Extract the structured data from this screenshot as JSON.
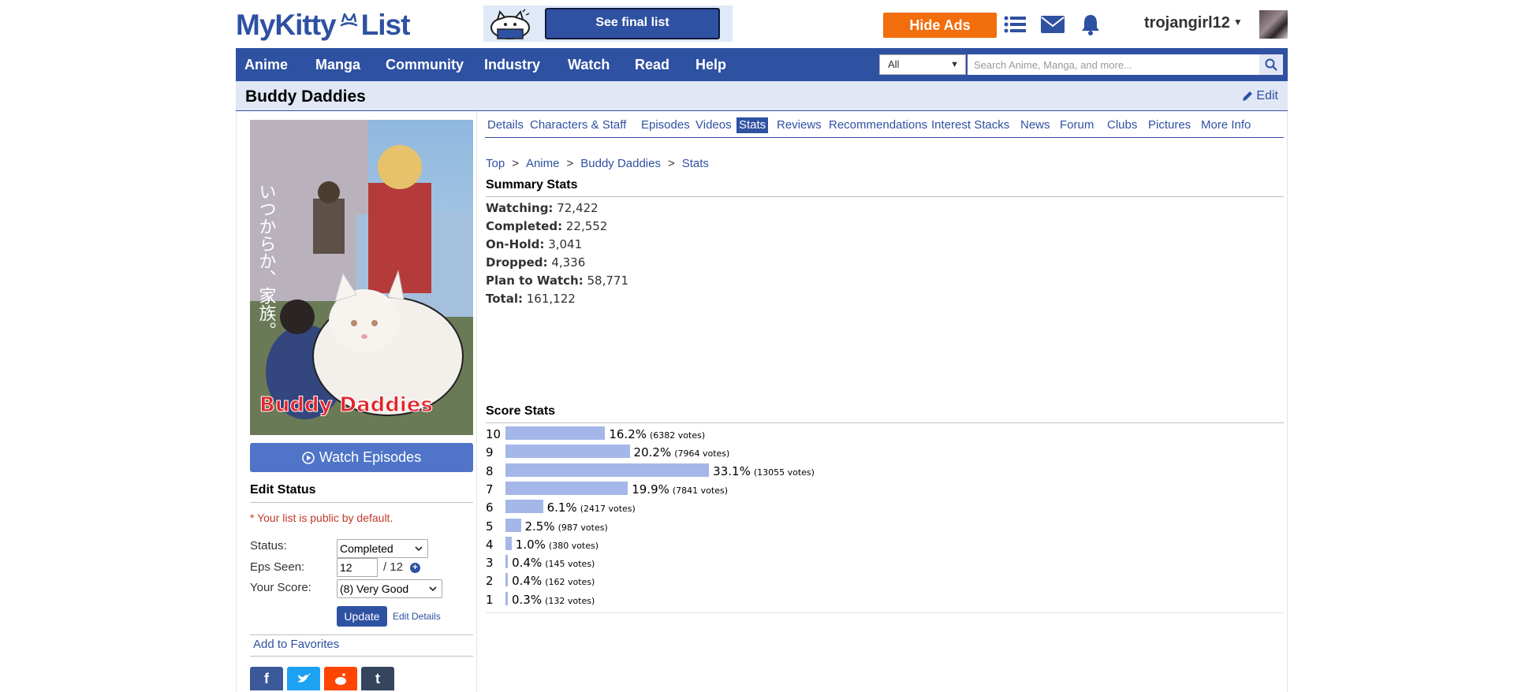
{
  "header": {
    "logo_text_left": "MyKitty",
    "logo_text_right": "List",
    "promo_button": "See final list",
    "hide_ads": "Hide Ads",
    "username": "trojangirl12"
  },
  "nav": {
    "items": [
      "Anime",
      "Manga",
      "Community",
      "Industry",
      "Watch",
      "Read",
      "Help"
    ],
    "search_category": "All",
    "search_placeholder": "Search Anime, Manga, and more..."
  },
  "title": {
    "name": "Buddy Daddies",
    "edit_label": "Edit"
  },
  "sidebar": {
    "poster_text_top": "いつからか、家族。",
    "poster_logo": "Buddy Daddies",
    "watch_episodes": "Watch Episodes",
    "edit_status_heading": "Edit Status",
    "public_note": "* Your list is public by default.",
    "status_label": "Status:",
    "status_value": "Completed",
    "eps_label": "Eps Seen:",
    "eps_value": "12",
    "eps_total": "/ 12",
    "score_label": "Your Score:",
    "score_value": "(8) Very Good",
    "update_button": "Update",
    "edit_details": "Edit Details",
    "add_favorites": "Add to Favorites",
    "share_icons": [
      "facebook-icon",
      "twitter-icon",
      "reddit-icon",
      "tumblr-icon"
    ]
  },
  "tabs": [
    "Details",
    "Characters & Staff",
    "Episodes",
    "Videos",
    "Stats",
    "Reviews",
    "Recommendations",
    "Interest Stacks",
    "News",
    "Forum",
    "Clubs",
    "Pictures",
    "More Info"
  ],
  "active_tab": "Stats",
  "breadcrumb": [
    "Top",
    "Anime",
    "Buddy Daddies",
    "Stats"
  ],
  "summary": {
    "heading": "Summary Stats",
    "rows": [
      {
        "label": "Watching:",
        "value": "72,422"
      },
      {
        "label": "Completed:",
        "value": "22,552"
      },
      {
        "label": "On-Hold:",
        "value": "3,041"
      },
      {
        "label": "Dropped:",
        "value": "4,336"
      },
      {
        "label": "Plan to Watch:",
        "value": "58,771"
      },
      {
        "label": "Total:",
        "value": "161,122"
      }
    ]
  },
  "score_stats": {
    "heading": "Score Stats",
    "rows": [
      {
        "score": "10",
        "pct": 16.2,
        "pct_label": "16.2%",
        "votes": "(6382 votes)"
      },
      {
        "score": "9",
        "pct": 20.2,
        "pct_label": "20.2%",
        "votes": "(7964 votes)"
      },
      {
        "score": "8",
        "pct": 33.1,
        "pct_label": "33.1%",
        "votes": "(13055 votes)"
      },
      {
        "score": "7",
        "pct": 19.9,
        "pct_label": "19.9%",
        "votes": "(7841 votes)"
      },
      {
        "score": "6",
        "pct": 6.1,
        "pct_label": "6.1%",
        "votes": "(2417 votes)"
      },
      {
        "score": "5",
        "pct": 2.5,
        "pct_label": "2.5%",
        "votes": "(987 votes)"
      },
      {
        "score": "4",
        "pct": 1.0,
        "pct_label": "1.0%",
        "votes": "(380 votes)"
      },
      {
        "score": "3",
        "pct": 0.4,
        "pct_label": "0.4%",
        "votes": "(145 votes)"
      },
      {
        "score": "2",
        "pct": 0.4,
        "pct_label": "0.4%",
        "votes": "(162 votes)"
      },
      {
        "score": "1",
        "pct": 0.3,
        "pct_label": "0.3%",
        "votes": "(132 votes)"
      }
    ]
  },
  "colors": {
    "brand_blue": "#2e51a2",
    "accent_orange": "#f26d0b",
    "bar_fill": "#a5b7e8"
  }
}
